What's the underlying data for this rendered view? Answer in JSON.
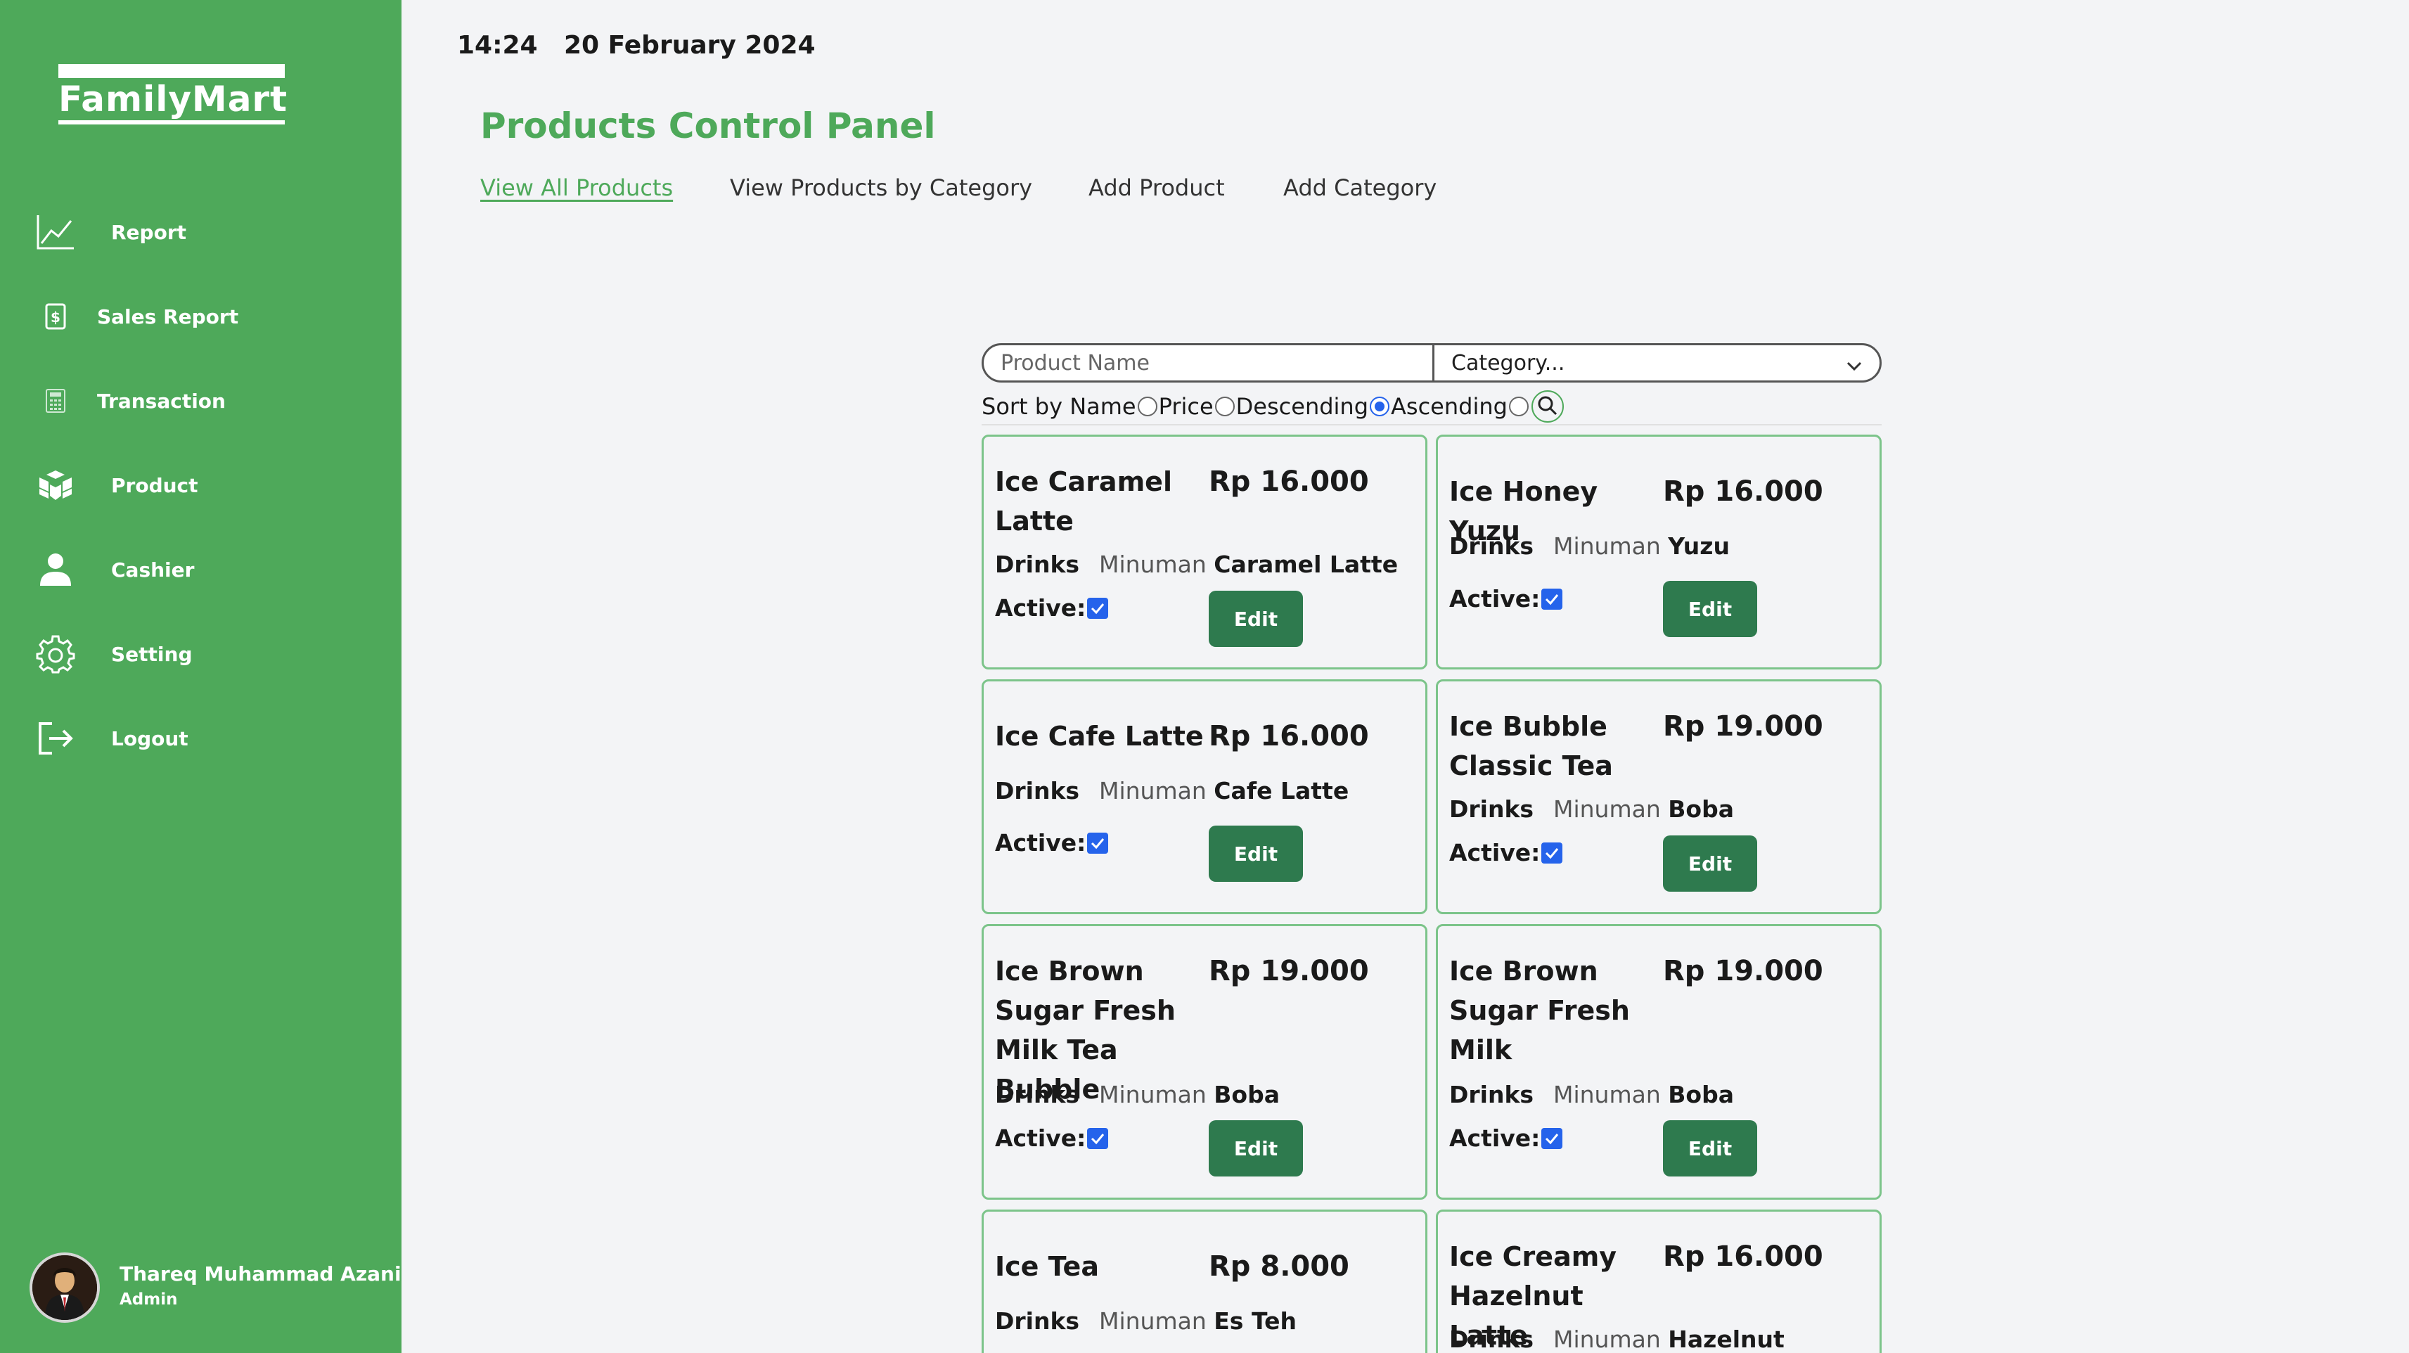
{
  "brand": {
    "logo_text": "FamilyMart",
    "accent": "#4ea95a",
    "button": "#2e7a4e"
  },
  "header": {
    "time": "14:24",
    "date": "20 February 2024"
  },
  "sidebar": {
    "items": [
      {
        "label": "Report",
        "icon": "line-chart-icon"
      },
      {
        "label": "Sales Report",
        "icon": "receipt-icon"
      },
      {
        "label": "Transaction",
        "icon": "calculator-icon"
      },
      {
        "label": "Product",
        "icon": "boxes-icon"
      },
      {
        "label": "Cashier",
        "icon": "person-icon"
      },
      {
        "label": "Setting",
        "icon": "gear-icon"
      },
      {
        "label": "Logout",
        "icon": "logout-icon"
      }
    ],
    "user": {
      "name": "Thareq Muhammad Azani",
      "role": "Admin"
    }
  },
  "main": {
    "title": "Products Control Panel",
    "tabs": [
      {
        "label": "View All Products",
        "active": true
      },
      {
        "label": "View Products by Category",
        "active": false
      },
      {
        "label": "Add Product",
        "active": false
      },
      {
        "label": "Add Category",
        "active": false
      }
    ],
    "search": {
      "placeholder": "Product Name",
      "category_value": "Category..."
    },
    "sort": {
      "label": "Sort by Name",
      "options": [
        "Price",
        "Descending",
        "Ascending"
      ],
      "checked": "Ascending"
    },
    "product_labels": {
      "active": "Active:",
      "edit": "Edit"
    },
    "products": [
      {
        "name": "Ice Caramel Latte",
        "price": "Rp 16.000",
        "category": "Drinks",
        "subcategory_prefix": "Minuman",
        "subcategory": "Caramel Latte",
        "active": true
      },
      {
        "name": "Ice Honey Yuzu",
        "price": "Rp 16.000",
        "category": "Drinks",
        "subcategory_prefix": "Minuman",
        "subcategory": "Yuzu",
        "active": true
      },
      {
        "name": "Ice Cafe Latte",
        "price": "Rp 16.000",
        "category": "Drinks",
        "subcategory_prefix": "Minuman",
        "subcategory": "Cafe Latte",
        "active": true
      },
      {
        "name": "Ice Bubble Classic Tea",
        "price": "Rp 19.000",
        "category": "Drinks",
        "subcategory_prefix": "Minuman",
        "subcategory": "Boba",
        "active": true
      },
      {
        "name": "Ice Brown Sugar Fresh Milk Tea Bubble",
        "price": "Rp 19.000",
        "category": "Drinks",
        "subcategory_prefix": "Minuman",
        "subcategory": "Boba",
        "active": true
      },
      {
        "name": "Ice Brown Sugar Fresh Milk",
        "price": "Rp 19.000",
        "category": "Drinks",
        "subcategory_prefix": "Minuman",
        "subcategory": "Boba",
        "active": true
      },
      {
        "name": "Ice Tea",
        "price": "Rp 8.000",
        "category": "Drinks",
        "subcategory_prefix": "Minuman",
        "subcategory": "Es Teh",
        "active": true
      },
      {
        "name": "Ice Creamy Hazelnut Latte",
        "price": "Rp 16.000",
        "category": "Drinks",
        "subcategory_prefix": "Minuman",
        "subcategory": "Hazelnut",
        "active": true
      }
    ]
  }
}
